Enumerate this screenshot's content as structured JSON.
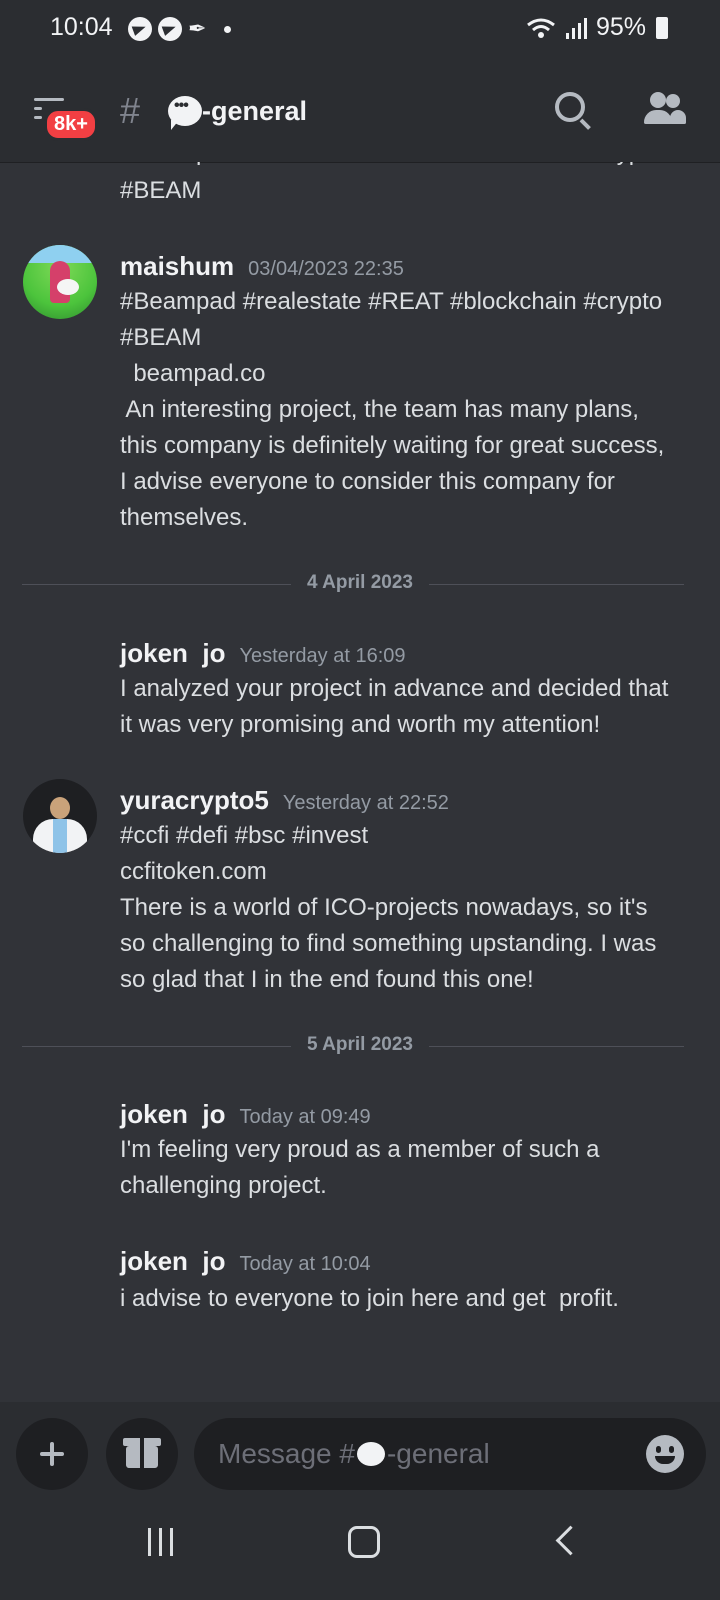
{
  "status_bar": {
    "time": "10:04",
    "battery": "95%"
  },
  "header": {
    "badge": "8k+",
    "channel": "-general"
  },
  "chat": {
    "top_partial": [
      "#Beampad #realestate #REAT #blockchain #crypto",
      "#BEAM"
    ],
    "messages": [
      {
        "author": "maishum",
        "timestamp": "03/04/2023 22:35",
        "lines": [
          "#Beampad #realestate #REAT #blockchain #crypto",
          "#BEAM",
          "  beampad.co",
          " An interesting project, the team has many plans,",
          "this company is definitely waiting for great success,",
          "I advise everyone to consider this company for",
          "themselves."
        ]
      },
      {
        "author": "joken  jo",
        "timestamp": "Yesterday at 16:09",
        "lines": [
          "I analyzed your project in advance and decided that",
          "it was very promising and worth my attention!"
        ]
      },
      {
        "author": "yuracrypto5",
        "timestamp": "Yesterday at 22:52",
        "lines": [
          "#ccfi #defi #bsc #invest",
          "ccfitoken.com",
          "There is a world of ICO-projects nowadays, so it's",
          "so challenging to find something upstanding. I was",
          "so glad that I in the end found this one!"
        ]
      },
      {
        "author": "joken  jo",
        "timestamp": "Today at 09:49",
        "lines": [
          "I'm feeling very proud as a member of such a",
          "challenging project."
        ]
      },
      {
        "author": "joken  jo",
        "timestamp": "Today at 10:04",
        "lines": [
          "i advise to everyone to join here and get  profit."
        ]
      }
    ],
    "dividers": [
      "4 April 2023",
      "5 April 2023"
    ]
  },
  "composer": {
    "placeholder_prefix": "Message #",
    "placeholder_suffix": "-general"
  },
  "icons": [
    "telegram-icon",
    "feather-icon",
    "wifi-icon",
    "signal-icon",
    "battery-icon",
    "menu-icon",
    "hash-icon",
    "speech-bubble-icon",
    "search-icon",
    "members-icon",
    "plus-icon",
    "gift-icon",
    "emoji-icon",
    "recents-icon",
    "home-icon",
    "back-icon"
  ],
  "colors": {
    "background": "#313338",
    "header": "#2b2d31",
    "badge": "#f23f43",
    "text": "#dbdee1",
    "muted": "#949ba4"
  }
}
